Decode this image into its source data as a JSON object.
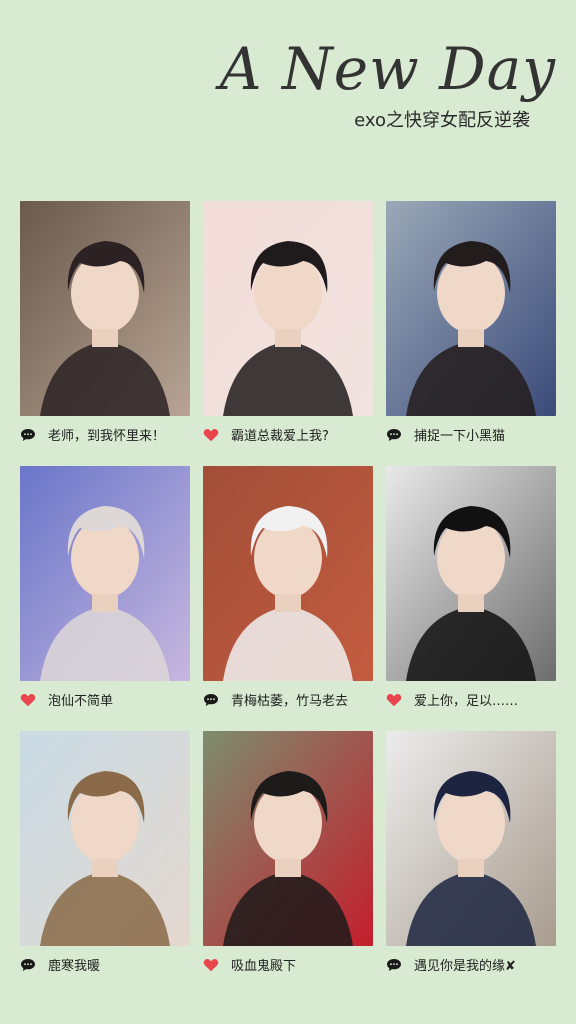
{
  "header": {
    "title": "A New Day",
    "subtitle": "exo之快穿女配反逆袭"
  },
  "cards": [
    {
      "icon": "comment-icon",
      "caption": "老师，到我怀里来！",
      "colors": [
        "#6b5a4d",
        "#b7a494",
        "#2c2224"
      ]
    },
    {
      "icon": "heart-icon",
      "caption": "霸道总裁爱上我?",
      "colors": [
        "#f3ddd8",
        "#f1e3e0",
        "#1f1a1c"
      ]
    },
    {
      "icon": "comment-icon",
      "caption": "捕捉一下小黑猫",
      "colors": [
        "#9aa8b7",
        "#3b4b7a",
        "#231c1c"
      ]
    },
    {
      "icon": "heart-icon",
      "caption": "泡仙不简单",
      "colors": [
        "#6a76c9",
        "#c7b7df",
        "#ddd7d8"
      ]
    },
    {
      "icon": "comment-icon",
      "caption": "青梅枯萎，竹马老去",
      "colors": [
        "#a24e38",
        "#c35c3f",
        "#f1f1f1"
      ]
    },
    {
      "icon": "heart-icon",
      "caption": "爱上你，足以……",
      "colors": [
        "#e9e9e9",
        "#6d6d6d",
        "#111111"
      ]
    },
    {
      "icon": "comment-icon",
      "caption": "鹿寒我暖",
      "colors": [
        "#c9dbe5",
        "#e4d8cf",
        "#8a6a48"
      ]
    },
    {
      "icon": "heart-icon",
      "caption": "吸血鬼殿下",
      "colors": [
        "#7d8d6f",
        "#c41e2c",
        "#1d1a1a"
      ]
    },
    {
      "icon": "comment-icon",
      "caption": "遇见你是我的缘✘",
      "colors": [
        "#ececec",
        "#a89c8e",
        "#1c2440"
      ]
    }
  ]
}
